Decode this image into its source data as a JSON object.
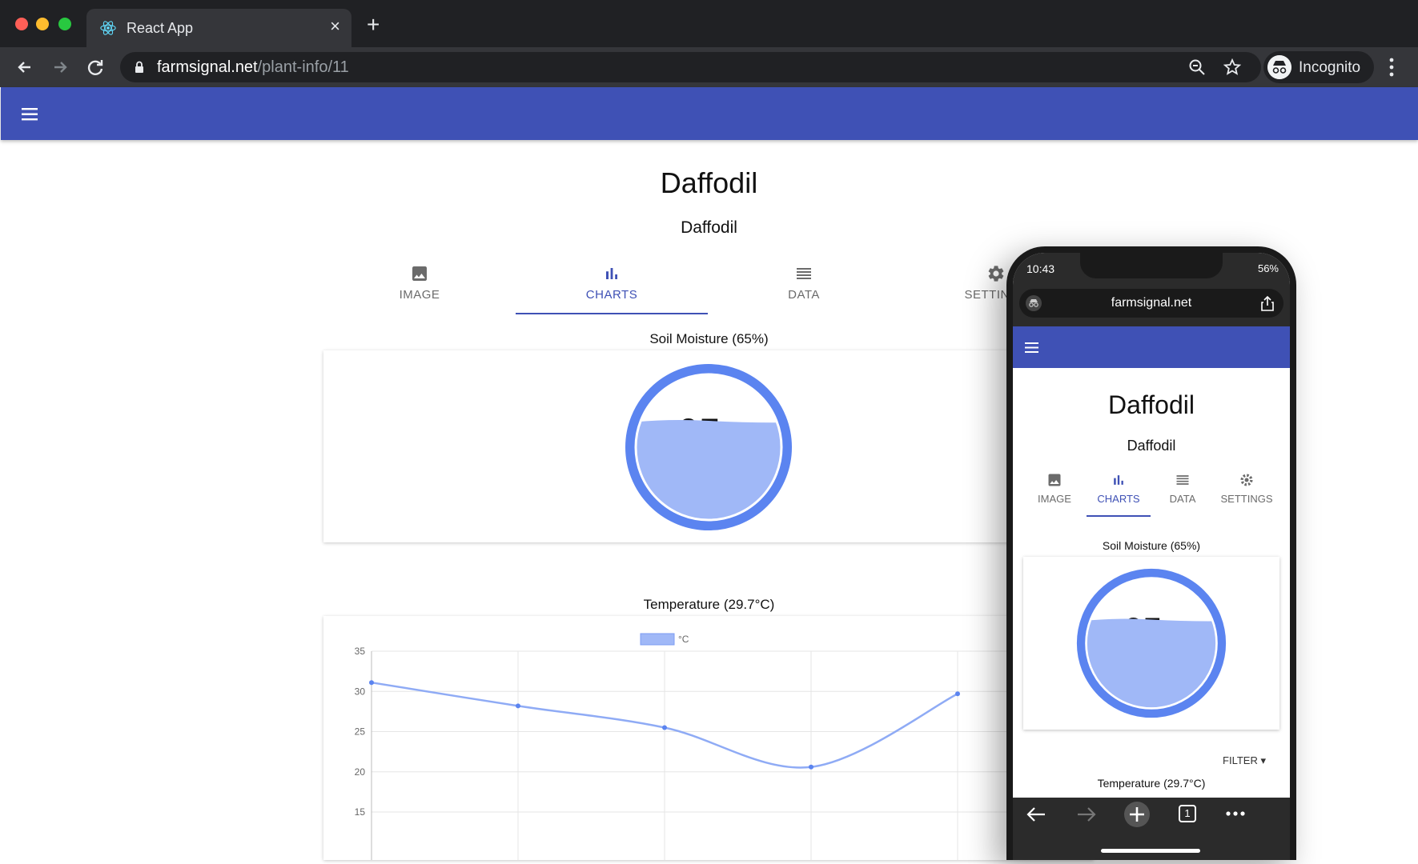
{
  "browser": {
    "tab_title": "React App",
    "new_tab": "+",
    "close_tab": "×",
    "url_domain": "farmsignal.net",
    "url_path": "/plant-info/11",
    "profile_label": "Incognito"
  },
  "page": {
    "title": "Daffodil",
    "subtitle": "Daffodil",
    "tabs": [
      {
        "label": "IMAGE",
        "icon": "image-icon"
      },
      {
        "label": "CHARTS",
        "icon": "bar-chart-icon",
        "active": true
      },
      {
        "label": "DATA",
        "icon": "list-icon"
      },
      {
        "label": "SETTINGS",
        "icon": "gear-icon"
      }
    ],
    "soil_title": "Soil Moisture (65%)",
    "soil_value": "65",
    "soil_unit": "%",
    "temp_title": "Temperature (29.7°C)",
    "accent": "#3f51b5",
    "gauge_color": "#5b84f0"
  },
  "chart_data": {
    "type": "line",
    "title": "Temperature (29.7°C)",
    "series": [
      {
        "name": "°C",
        "values": [
          31.1,
          28.2,
          25.5,
          20.6,
          29.7
        ]
      }
    ],
    "x": [
      0,
      1,
      2,
      3,
      4
    ],
    "ylim": [
      15,
      35
    ],
    "yticks": [
      35,
      30,
      25,
      20,
      15
    ],
    "grid": true,
    "legend": "top"
  },
  "mobile": {
    "time": "10:43",
    "battery": "56%",
    "url": "farmsignal.net",
    "title": "Daffodil",
    "subtitle": "Daffodil",
    "tabs": [
      "IMAGE",
      "CHARTS",
      "DATA",
      "SETTINGS"
    ],
    "soil_title": "Soil Moisture (65%)",
    "soil_value": "65",
    "soil_unit": "%",
    "filter_label": "FILTER",
    "temp_title": "Temperature (29.7°C)",
    "tab_count": "1"
  }
}
